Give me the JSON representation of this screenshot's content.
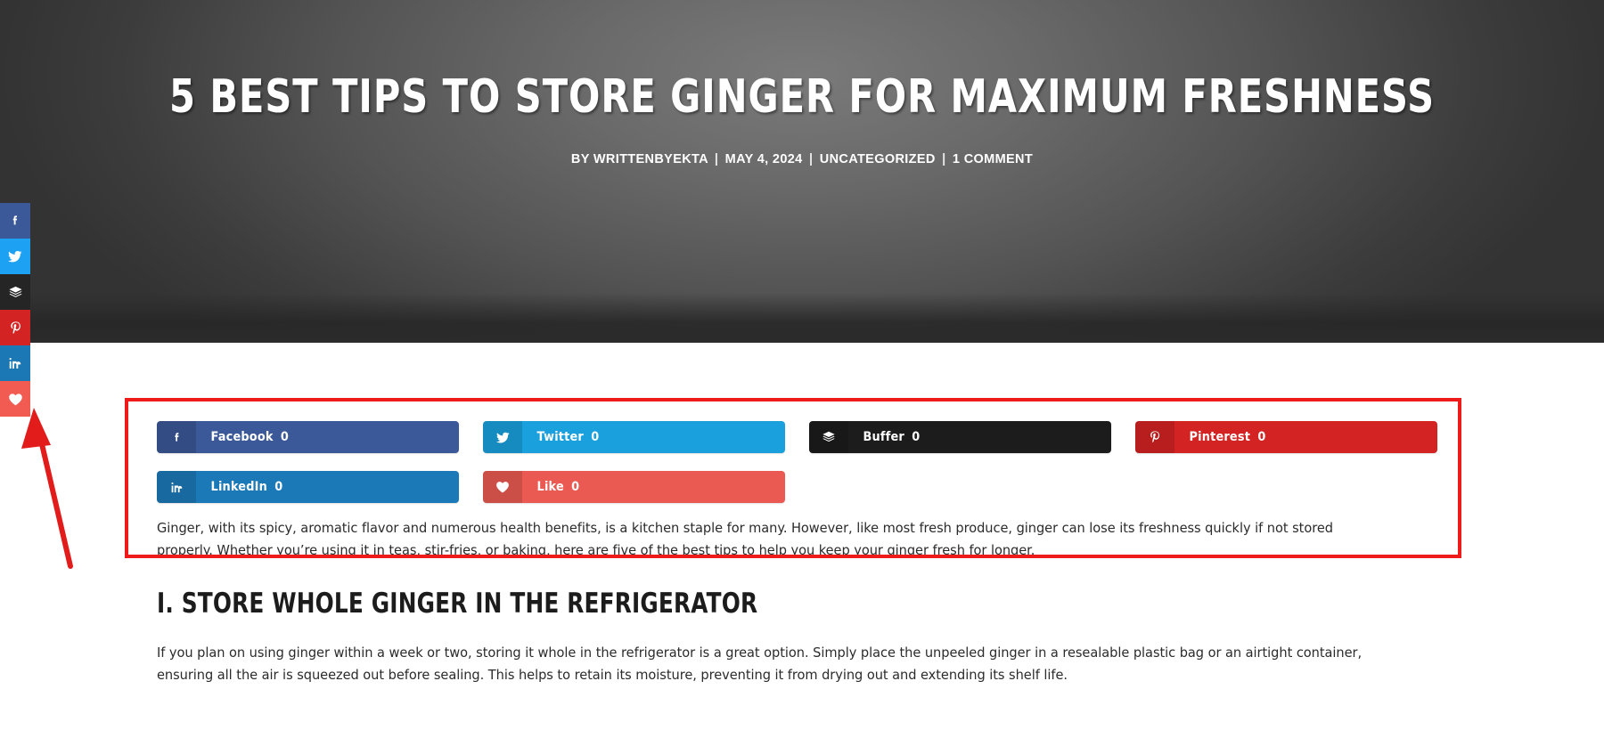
{
  "hero": {
    "title": "5 BEST TIPS TO STORE GINGER FOR MAXIMUM FRESHNESS",
    "meta": {
      "author": "BY WRITTENBYEKTA",
      "date": "MAY 4, 2024",
      "category": "UNCATEGORIZED",
      "comments": "1 COMMENT",
      "separator": "|"
    }
  },
  "share_rail": {
    "items": [
      {
        "name": "facebook",
        "icon": "facebook-icon",
        "color": "#3b5998"
      },
      {
        "name": "twitter",
        "icon": "twitter-icon",
        "color": "#1da1f2"
      },
      {
        "name": "buffer",
        "icon": "buffer-icon",
        "color": "#252525"
      },
      {
        "name": "pinterest",
        "icon": "pinterest-icon",
        "color": "#d32323"
      },
      {
        "name": "linkedin",
        "icon": "linkedin-icon",
        "color": "#1c78b4"
      },
      {
        "name": "like",
        "icon": "heart-icon",
        "color": "#f15b51"
      }
    ]
  },
  "share_buttons": {
    "row1": [
      {
        "label": "Facebook",
        "count": "0",
        "icon": "facebook-icon",
        "color": "#3b5998"
      },
      {
        "label": "Twitter",
        "count": "0",
        "icon": "twitter-icon",
        "color": "#19a0dd"
      },
      {
        "label": "Buffer",
        "count": "0",
        "icon": "buffer-icon",
        "color": "#1c1c1c"
      },
      {
        "label": "Pinterest",
        "count": "0",
        "icon": "pinterest-icon",
        "color": "#d42323"
      }
    ],
    "row2": [
      {
        "label": "LinkedIn",
        "count": "0",
        "icon": "linkedin-icon",
        "color": "#1c79b8"
      },
      {
        "label": "Like",
        "count": "0",
        "icon": "heart-icon",
        "color": "#ea5a52"
      }
    ]
  },
  "article": {
    "intro": "Ginger, with its spicy, aromatic flavor and numerous health benefits, is a kitchen staple for many. However, like most fresh produce, ginger can lose its freshness quickly if not stored properly. Whether you’re using it in teas, stir-fries, or baking, here are five of the best tips to help you keep your ginger fresh for longer.",
    "heading1": "I. STORE WHOLE GINGER IN THE REFRIGERATOR",
    "para1": "If you plan on using ginger within a week or two, storing it whole in the refrigerator is a great option. Simply place the unpeeled ginger in a resealable plastic bag or an airtight container, ensuring all the air is squeezed out before sealing. This helps to retain its moisture, preventing it from drying out and extending its shelf life."
  },
  "annotation": {
    "highlight_color": "#ee1b1b",
    "arrow_color": "#e21b1b"
  }
}
